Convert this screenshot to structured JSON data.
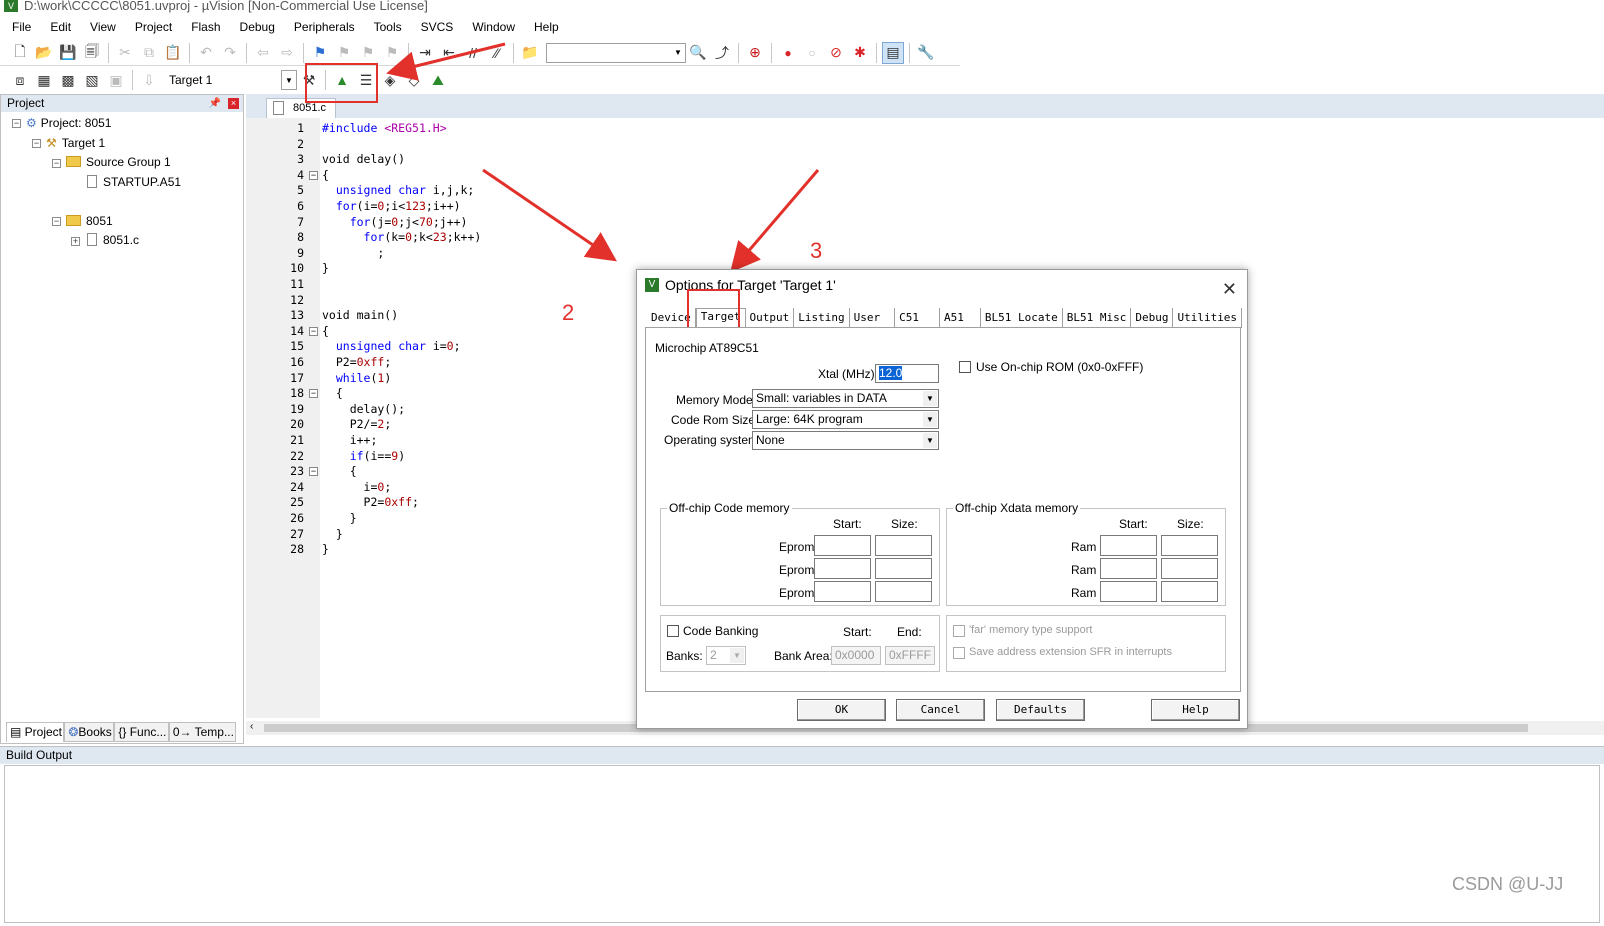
{
  "window": {
    "title": "D:\\work\\CCCCC\\8051.uvproj - µVision  [Non-Commercial Use License]"
  },
  "menu": [
    "File",
    "Edit",
    "View",
    "Project",
    "Flash",
    "Debug",
    "Peripherals",
    "Tools",
    "SVCS",
    "Window",
    "Help"
  ],
  "toolbar": {
    "target_select": "Target 1"
  },
  "project_panel": {
    "header": "Project",
    "tree": {
      "project": "Project: 8051",
      "target": "Target 1",
      "group1": "Source Group 1",
      "file1": "STARTUP.A51",
      "group2": "8051",
      "file2": "8051.c"
    },
    "tabs": [
      "Project",
      "Books",
      "{} Func...",
      "0→ Temp..."
    ]
  },
  "editor": {
    "tab": "8051.c",
    "lines": [
      "#include <REG51.H>",
      "",
      "void delay()",
      "{",
      "  unsigned char i,j,k;",
      "  for(i=0;i<123;i++)",
      "    for(j=0;j<70;j++)",
      "      for(k=0;k<23;k++)",
      "        ;",
      "}",
      "",
      "",
      "void main()",
      "{",
      "  unsigned char i=0;",
      "  P2=0xff;",
      "  while(1)",
      "  {",
      "    delay();",
      "    P2/=2;",
      "    i++;",
      "    if(i==9)",
      "    {",
      "      i=0;",
      "      P2=0xff;",
      "    }",
      "  }",
      "}"
    ]
  },
  "build_output": {
    "header": "Build Output"
  },
  "annotations": {
    "label2": "2",
    "label3": "3",
    "color": "#e2302b"
  },
  "watermark": "CSDN @U-JJ",
  "dialog": {
    "title": "Options for Target 'Target 1'",
    "tabs": [
      "Device",
      "Target",
      "Output",
      "Listing",
      "User",
      "C51",
      "A51",
      "BL51 Locate",
      "BL51 Misc",
      "Debug",
      "Utilities"
    ],
    "active_tab": "Target",
    "device_name": "Microchip AT89C51",
    "xtal_label": "Xtal (MHz):",
    "xtal_value": "12.0",
    "onchip_rom": "Use On-chip ROM (0x0-0xFFF)",
    "memory_model_label": "Memory Model:",
    "memory_model_value": "Small: variables in DATA",
    "code_rom_label": "Code Rom Size:",
    "code_rom_value": "Large: 64K program",
    "os_label": "Operating system:",
    "os_value": "None",
    "offchip_code": {
      "title": "Off-chip Code memory",
      "start": "Start:",
      "size": "Size:",
      "rows": [
        "Eprom",
        "Eprom",
        "Eprom"
      ]
    },
    "offchip_xdata": {
      "title": "Off-chip Xdata memory",
      "start": "Start:",
      "size": "Size:",
      "rows": [
        "Ram",
        "Ram",
        "Ram"
      ]
    },
    "code_banking": "Code Banking",
    "banks_label": "Banks:",
    "banks_value": "2",
    "bank_area_label": "Bank Area:",
    "bank_start_label": "Start:",
    "bank_end_label": "End:",
    "bank_start": "0x0000",
    "bank_end": "0xFFFF",
    "far_memory": "'far' memory type support",
    "save_sfr": "Save address extension SFR in interrupts",
    "buttons": {
      "ok": "OK",
      "cancel": "Cancel",
      "defaults": "Defaults",
      "help": "Help"
    }
  }
}
